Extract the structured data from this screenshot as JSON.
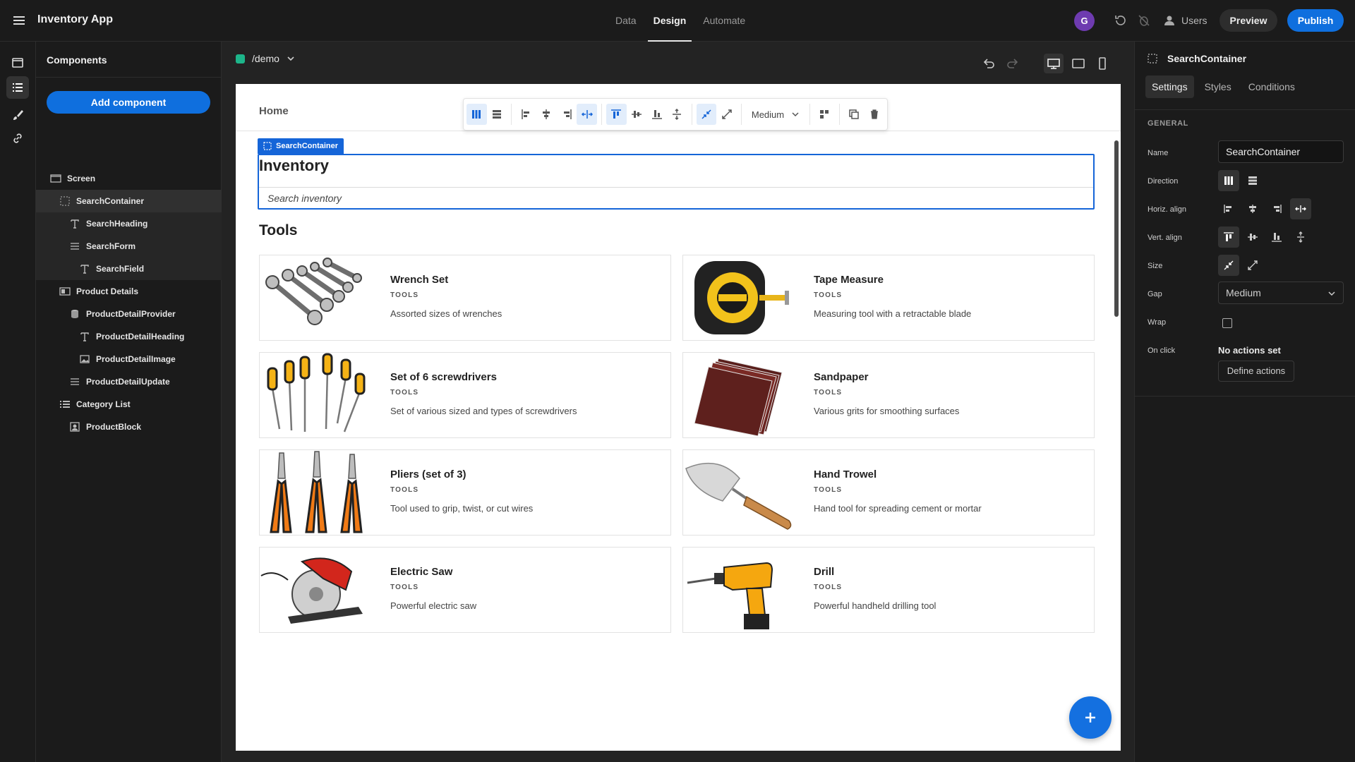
{
  "app": {
    "title": "Inventory App",
    "nav_tabs": [
      "Data",
      "Design",
      "Automate"
    ],
    "active_tab": "Design",
    "avatar_initial": "G",
    "users_label": "Users",
    "preview_label": "Preview",
    "publish_label": "Publish",
    "accent_color": "#0f6fde"
  },
  "components_panel": {
    "title": "Components",
    "add_button": "Add component",
    "tree": [
      {
        "label": "Screen",
        "icon": "screen-icon",
        "depth": 0
      },
      {
        "label": "SearchContainer",
        "icon": "container-icon",
        "depth": 1,
        "selected": true
      },
      {
        "label": "SearchHeading",
        "icon": "text-icon",
        "depth": 2
      },
      {
        "label": "SearchForm",
        "icon": "form-icon",
        "depth": 2
      },
      {
        "label": "SearchField",
        "icon": "text-icon",
        "depth": 3
      },
      {
        "label": "Product Details",
        "icon": "panel-icon",
        "depth": 1
      },
      {
        "label": "ProductDetailProvider",
        "icon": "database-icon",
        "depth": 2
      },
      {
        "label": "ProductDetailHeading",
        "icon": "text-icon",
        "depth": 3
      },
      {
        "label": "ProductDetailImage",
        "icon": "image-icon",
        "depth": 3
      },
      {
        "label": "ProductDetailUpdate",
        "icon": "form-icon",
        "depth": 2
      },
      {
        "label": "Category List",
        "icon": "list-icon",
        "depth": 1
      },
      {
        "label": "ProductBlock",
        "icon": "block-icon",
        "depth": 2
      }
    ]
  },
  "canvas": {
    "route": "/demo",
    "page_heading": "Home",
    "toolbar_gap": "Medium",
    "selected_tag": "SearchContainer",
    "search_heading": "Inventory",
    "search_placeholder": "Search inventory",
    "section_heading": "Tools",
    "products": [
      {
        "name": "Wrench Set",
        "category": "TOOLS",
        "description": "Assorted sizes of wrenches",
        "image": "wrench-image"
      },
      {
        "name": "Tape Measure",
        "category": "TOOLS",
        "description": "Measuring tool with a retractable blade",
        "image": "tape-measure-image"
      },
      {
        "name": "Set of 6 screwdrivers",
        "category": "TOOLS",
        "description": "Set of various sized and types of screwdrivers",
        "image": "screwdriver-image"
      },
      {
        "name": "Sandpaper",
        "category": "TOOLS",
        "description": "Various grits for smoothing surfaces",
        "image": "sandpaper-image"
      },
      {
        "name": "Pliers (set of 3)",
        "category": "TOOLS",
        "description": "Tool used to grip, twist, or cut wires",
        "image": "pliers-image"
      },
      {
        "name": "Hand Trowel",
        "category": "TOOLS",
        "description": "Hand tool for spreading cement or mortar",
        "image": "trowel-image"
      },
      {
        "name": "Electric Saw",
        "category": "TOOLS",
        "description": "Powerful electric saw",
        "image": "saw-image"
      },
      {
        "name": "Drill",
        "category": "TOOLS",
        "description": "Powerful handheld drilling tool",
        "image": "drill-image"
      }
    ]
  },
  "settings_panel": {
    "component_name": "SearchContainer",
    "tabs": [
      "Settings",
      "Styles",
      "Conditions"
    ],
    "active_tab": "Settings",
    "section": "GENERAL",
    "labels": {
      "name": "Name",
      "direction": "Direction",
      "horiz_align": "Horiz. align",
      "vert_align": "Vert. align",
      "size": "Size",
      "gap": "Gap",
      "wrap": "Wrap",
      "on_click": "On click"
    },
    "name_value": "SearchContainer",
    "gap_value": "Medium",
    "wrap_checked": false,
    "no_actions": "No actions set",
    "define_actions": "Define actions"
  }
}
